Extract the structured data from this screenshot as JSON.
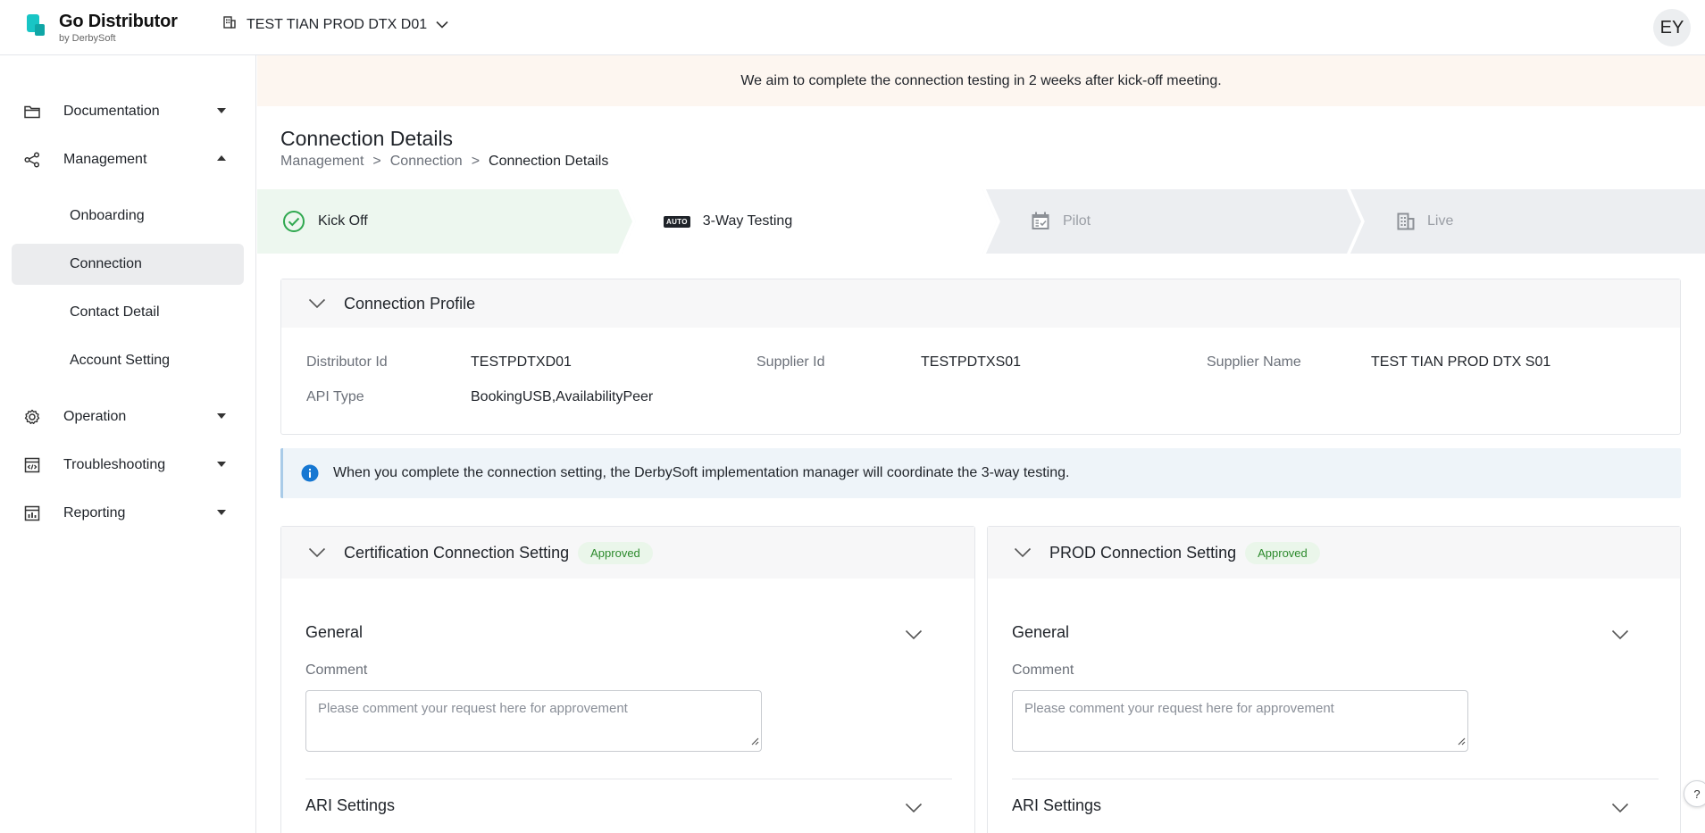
{
  "app": {
    "name": "Go Distributor",
    "by": "by DerbySoft"
  },
  "tenant": {
    "name": "TEST TIAN PROD DTX D01"
  },
  "user": {
    "initials": "EY"
  },
  "sidebar": {
    "items": [
      {
        "label": "Documentation",
        "icon": "folder-icon",
        "expanded": false
      },
      {
        "label": "Management",
        "icon": "share-icon",
        "expanded": true,
        "children": [
          {
            "label": "Onboarding"
          },
          {
            "label": "Connection",
            "active": true
          },
          {
            "label": "Contact Detail"
          },
          {
            "label": "Account Setting"
          }
        ]
      },
      {
        "label": "Operation",
        "icon": "gear-icon",
        "expanded": false
      },
      {
        "label": "Troubleshooting",
        "icon": "code-window-icon",
        "expanded": false
      },
      {
        "label": "Reporting",
        "icon": "report-chart-icon",
        "expanded": false
      }
    ]
  },
  "banner": {
    "text": "We aim to complete the connection testing in 2 weeks after kick-off meeting."
  },
  "page": {
    "title": "Connection Details",
    "breadcrumb": [
      "Management",
      "Connection",
      "Connection Details"
    ],
    "separator": ">"
  },
  "stepper": {
    "steps": [
      {
        "label": "Kick Off",
        "status": "done",
        "icon": "check-circle-icon"
      },
      {
        "label": "3-Way Testing",
        "status": "current",
        "icon": "auto-badge-icon",
        "icon_text": "AUTO"
      },
      {
        "label": "Pilot",
        "status": "upcoming",
        "icon": "calendar-check-icon"
      },
      {
        "label": "Live",
        "status": "upcoming",
        "icon": "building-icon"
      }
    ]
  },
  "profile": {
    "title": "Connection Profile",
    "fields": [
      {
        "key": "Distributor Id",
        "value": "TESTPDTXD01"
      },
      {
        "key": "Supplier Id",
        "value": "TESTPDTXS01"
      },
      {
        "key": "Supplier Name",
        "value": "TEST TIAN PROD DTX S01"
      },
      {
        "key": "API Type",
        "value": "BookingUSB,AvailabilityPeer"
      }
    ]
  },
  "info": {
    "text": "When you complete the connection setting, the DerbySoft implementation manager will coordinate the 3-way testing."
  },
  "settings": [
    {
      "title": "Certification Connection Setting",
      "badge": "Approved",
      "general": "General",
      "comment_label": "Comment",
      "comment_placeholder": "Please comment your request here for approvement",
      "ari": "ARI Settings"
    },
    {
      "title": "PROD Connection Setting",
      "badge": "Approved",
      "general": "General",
      "comment_label": "Comment",
      "comment_placeholder": "Please comment your request here for approvement",
      "ari": "ARI Settings"
    }
  ],
  "help": {
    "label": "?"
  },
  "colors": {
    "accent": "#18c5c5",
    "success": "#2c8a2c",
    "info": "#1677d2",
    "done_step_bg": "#edf7ef"
  }
}
